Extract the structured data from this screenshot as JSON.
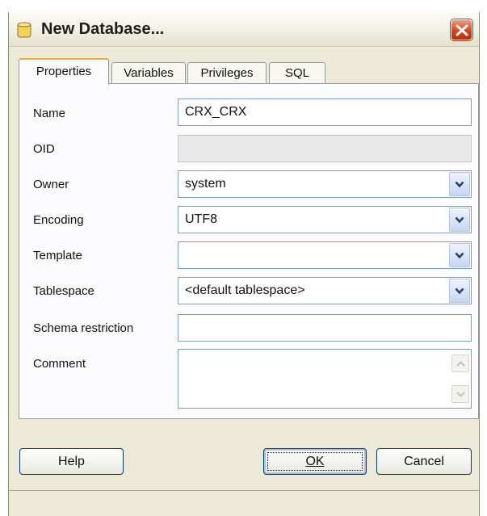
{
  "window": {
    "title": "New Database..."
  },
  "tabs": [
    {
      "label": "Properties",
      "active": true
    },
    {
      "label": "Variables",
      "active": false
    },
    {
      "label": "Privileges",
      "active": false
    },
    {
      "label": "SQL",
      "active": false
    }
  ],
  "form": {
    "name": {
      "label": "Name",
      "value": "CRX_CRX"
    },
    "oid": {
      "label": "OID",
      "value": ""
    },
    "owner": {
      "label": "Owner",
      "value": "system"
    },
    "encoding": {
      "label": "Encoding",
      "value": "UTF8"
    },
    "template": {
      "label": "Template",
      "value": ""
    },
    "tablespace": {
      "label": "Tablespace",
      "value": "<default tablespace>"
    },
    "schema_restriction": {
      "label": "Schema restriction",
      "value": ""
    },
    "comment": {
      "label": "Comment",
      "value": ""
    }
  },
  "buttons": {
    "help": "Help",
    "ok": "OK",
    "cancel": "Cancel"
  },
  "icons": {
    "title_icon": "database-icon",
    "close": "close-icon",
    "dropdown": "chevron-down-icon"
  },
  "colors": {
    "tab_accent": "#f2a63b",
    "close_button": "#d6431e",
    "field_border": "#7f9db9"
  }
}
